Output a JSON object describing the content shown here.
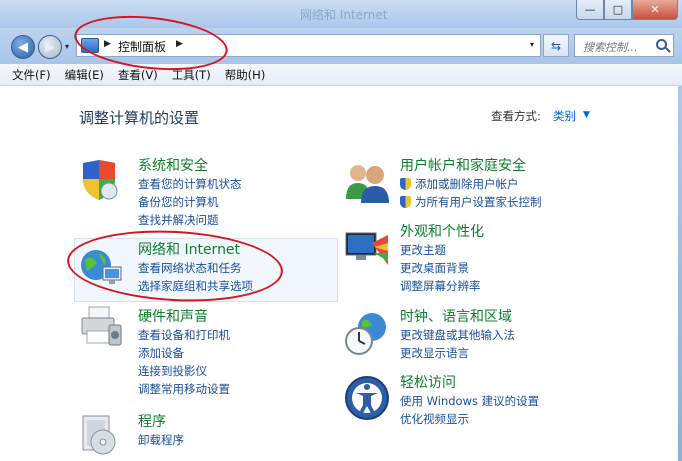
{
  "window": {
    "title_ghost": "网络和 Internet"
  },
  "caption": {
    "min": "—",
    "max": "□",
    "close": "✕"
  },
  "nav": {
    "back": "◀",
    "forward": "▶",
    "history_caret": "▾",
    "address_text": "控制面板",
    "sep1": "▶",
    "sep2": "▶",
    "address_caret": "▾",
    "refresh": "⇆",
    "search_placeholder": "搜索控制..."
  },
  "menu": [
    "文件(F)",
    "编辑(E)",
    "查看(V)",
    "工具(T)",
    "帮助(H)"
  ],
  "main": {
    "title": "调整计算机的设置",
    "view_by_label": "查看方式:",
    "view_by_value": "类别",
    "view_by_caret": "▼"
  },
  "categories": {
    "security": {
      "title": "系统和安全",
      "links": [
        "查看您的计算机状态",
        "备份您的计算机",
        "查找并解决问题"
      ]
    },
    "network": {
      "title": "网络和 Internet",
      "links": [
        "查看网络状态和任务",
        "选择家庭组和共享选项"
      ]
    },
    "hardware": {
      "title": "硬件和声音",
      "links": [
        "查看设备和打印机",
        "添加设备",
        "连接到投影仪",
        "调整常用移动设置"
      ]
    },
    "programs": {
      "title": "程序",
      "links": [
        "卸载程序"
      ]
    },
    "users": {
      "title": "用户帐户和家庭安全",
      "links": [
        "添加或删除用户帐户",
        "为所有用户设置家长控制"
      ]
    },
    "appearance": {
      "title": "外观和个性化",
      "links": [
        "更改主题",
        "更改桌面背景",
        "调整屏幕分辨率"
      ]
    },
    "clock": {
      "title": "时钟、语言和区域",
      "links": [
        "更改键盘或其他输入法",
        "更改显示语言"
      ]
    },
    "ease": {
      "title": "轻松访问",
      "links": [
        "使用 Windows 建议的设置",
        "优化视频显示"
      ]
    }
  },
  "colors": {
    "category_title": "#0e7e2e",
    "link": "#1a4f9e",
    "annotation": "#d8141e"
  }
}
